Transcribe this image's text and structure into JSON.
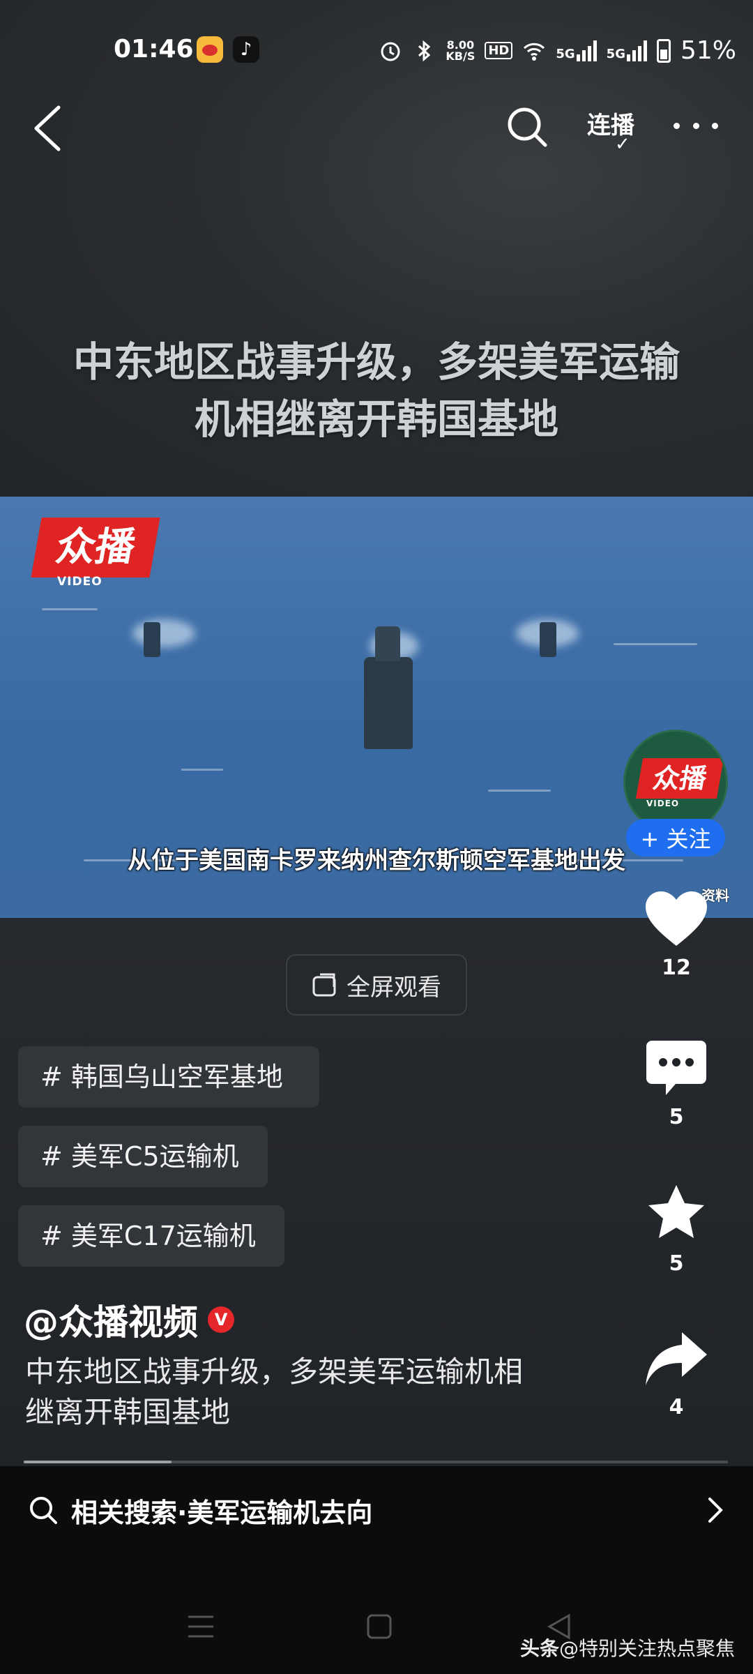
{
  "status_bar": {
    "time": "01:46",
    "net_speed_value": "8.00",
    "net_speed_unit": "KB/S",
    "hd_label": "HD",
    "sig1": "5G",
    "sig2": "5G",
    "battery": "51%"
  },
  "nav": {
    "lianbo": "连播"
  },
  "headline": {
    "line1": "中东地区战事升级，多架美军运输",
    "line2": "机相继离开韩国基地"
  },
  "video": {
    "logo_text": "众播",
    "logo_sub": "VIDEO",
    "subtitle": "从位于美国南卡罗来纳州查尔斯顿空军基地出发",
    "corner_note": "资料",
    "progress_fraction": 0.21
  },
  "author_badge": {
    "follow_label": "+ 关注"
  },
  "actions": {
    "likes": "12",
    "comments": "5",
    "favorites": "5",
    "shares": "4"
  },
  "fullscreen_label": "全屏观看",
  "tags": [
    "# 韩国乌山空军基地",
    "# 美军C5运输机",
    "# 美军C17运输机"
  ],
  "author_name": "@众播视频",
  "verified_mark": "V",
  "description": {
    "line1": "中东地区战事升级，多架美军运输机相",
    "line2": "继离开韩国基地"
  },
  "related_search": "相关搜索·美军运输机去向",
  "watermark": {
    "brand": "头条",
    "handle": "@特别关注热点聚焦"
  },
  "colors": {
    "follow_blue": "#1f6ef0",
    "brand_red": "#e02424"
  }
}
